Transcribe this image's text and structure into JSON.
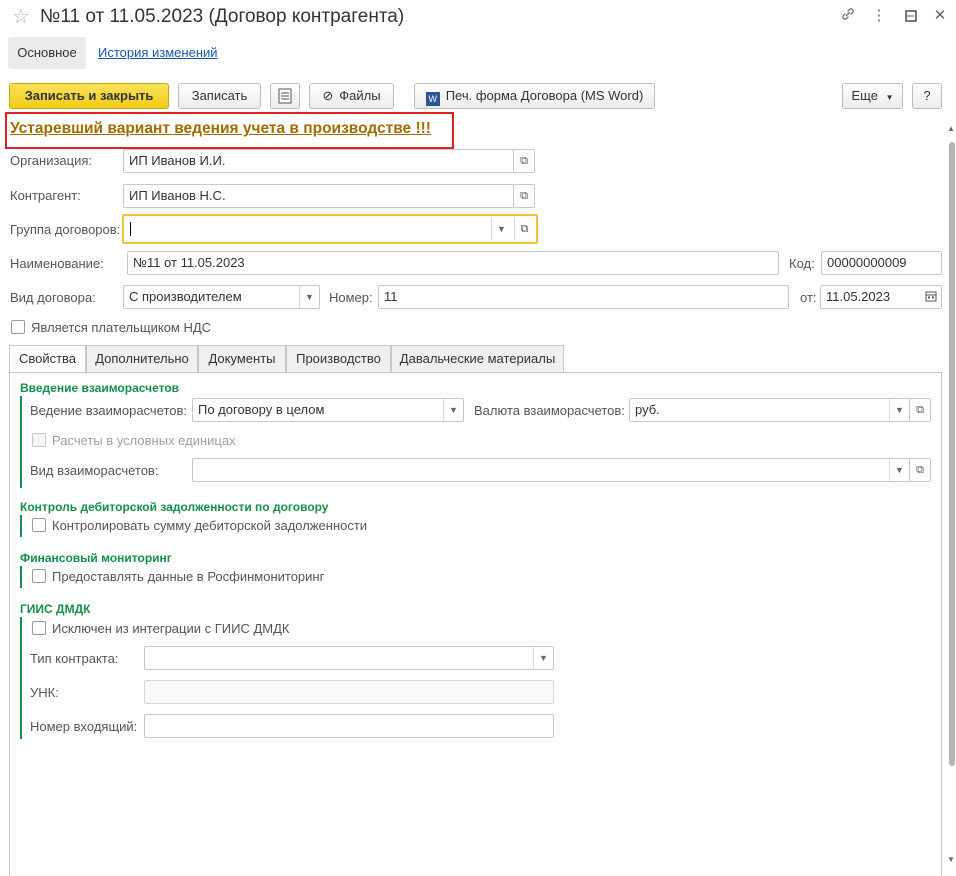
{
  "window": {
    "title": "№11 от 11.05.2023 (Договор контрагента)",
    "link_icon": "🔗",
    "more_icon": "⋮",
    "minimize_icon": "–",
    "maximize_icon": "□",
    "close_icon": "✕"
  },
  "nav": {
    "main_tab": "Основное",
    "history_link": "История изменений"
  },
  "toolbar": {
    "save_close": "Записать и закрыть",
    "save": "Записать",
    "files": "Файлы",
    "print_form": "Печ. форма Договора (MS Word)",
    "more": "Еще",
    "help": "?"
  },
  "warning": "Устаревший вариант ведения учета в производстве !!!",
  "form": {
    "organization_label": "Организация:",
    "organization_value": "ИП Иванов И.И.",
    "counterparty_label": "Контрагент:",
    "counterparty_value": "ИП Иванов Н.С.",
    "contract_group_label": "Группа договоров:",
    "contract_group_value": "",
    "name_label": "Наименование:",
    "name_value": "№11 от 11.05.2023",
    "code_label": "Код:",
    "code_value": "00000000009",
    "contract_type_label": "Вид договора:",
    "contract_type_value": "С производителем",
    "number_label": "Номер:",
    "number_value": "11",
    "date_label": "от:",
    "date_value": "11.05.2023",
    "vat_payer_label": "Является плательщиком НДС",
    "vat_payer_checked": false
  },
  "tabs": [
    "Свойства",
    "Дополнительно",
    "Документы",
    "Производство",
    "Давальческие материалы"
  ],
  "properties": {
    "settlements_group": "Введение взаиморасчетов",
    "settlements_mode_label": "Ведение взаиморасчетов:",
    "settlements_mode_value": "По договору в целом",
    "currency_label": "Валюта взаиморасчетов:",
    "currency_value": "руб.",
    "conventional_units_label": "Расчеты в условных единицах",
    "settlement_kind_label": "Вид взаиморасчетов:",
    "settlement_kind_value": "",
    "receivables_group": "Контроль дебиторской задолженности по договору",
    "receivables_check_label": "Контролировать сумму дебиторской задолженности",
    "finmon_group": "Финансовый мониторинг",
    "finmon_check_label": "Предоставлять данные в Росфинмониторинг",
    "giis_group": "ГИИС ДМДК",
    "giis_excluded_label": "Исключен из интеграции с ГИИС ДМДК",
    "contract_kind_label": "Тип контракта:",
    "contract_kind_value": "",
    "unk_label": "УНК:",
    "unk_value": "",
    "incoming_number_label": "Номер входящий:",
    "incoming_number_value": ""
  }
}
